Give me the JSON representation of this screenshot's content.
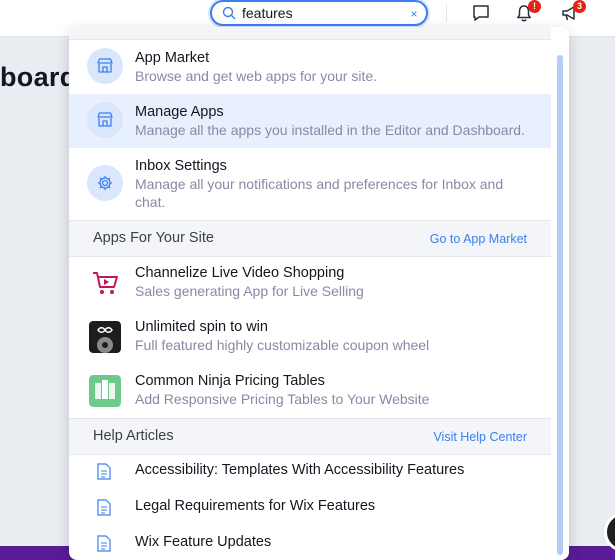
{
  "page": {
    "heading": "board"
  },
  "search": {
    "value": "features",
    "clear_label": "×"
  },
  "header": {
    "notifications_badge": "!",
    "announcements_badge": "3"
  },
  "results": {
    "items": [
      {
        "title": "App Market",
        "desc": "Browse and get web apps for your site.",
        "icon": "store-icon"
      },
      {
        "title": "Manage Apps",
        "desc": "Manage all the apps you installed in the Editor and Dashboard.",
        "icon": "store-icon"
      },
      {
        "title": "Inbox Settings",
        "desc": "Manage all your notifications and preferences for Inbox and chat.",
        "icon": "gear-icon"
      }
    ],
    "apps_section": {
      "label": "Apps For Your Site",
      "link": "Go to App Market"
    },
    "apps": [
      {
        "title": "Channelize Live Video Shopping",
        "desc": "Sales generating App for Live Selling"
      },
      {
        "title": "Unlimited spin to win",
        "desc": "Full featured highly customizable coupon wheel"
      },
      {
        "title": "Common Ninja Pricing Tables",
        "desc": "Add Responsive Pricing Tables to Your Website"
      }
    ],
    "help_section": {
      "label": "Help Articles",
      "link": "Visit Help Center"
    },
    "articles": [
      "Accessibility: Templates With Accessibility Features",
      "Legal Requirements for Wix Features",
      "Wix Feature Updates"
    ]
  },
  "colors": {
    "accent": "#3b7ff0",
    "highlight": "#e8f0fe",
    "badge": "#e62214"
  }
}
